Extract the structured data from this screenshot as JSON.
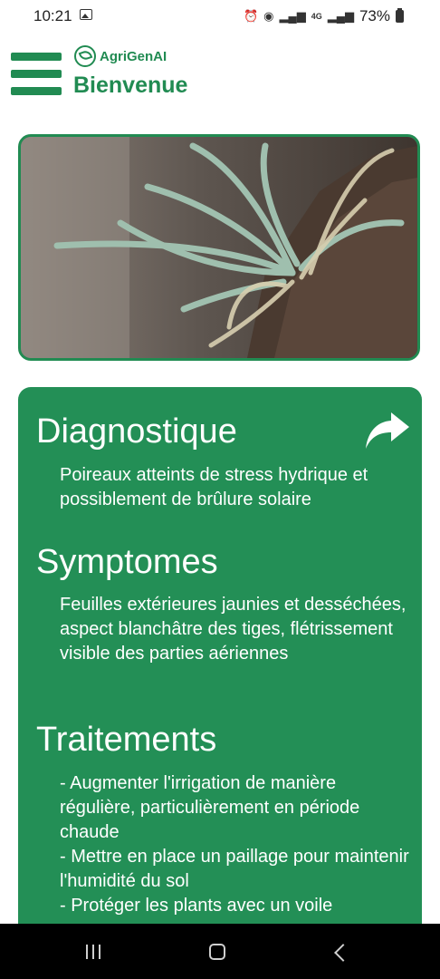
{
  "status_bar": {
    "time": "10:21",
    "network": "4G",
    "battery": "73%"
  },
  "app": {
    "logo_text": "AgriGenAI",
    "title": "Bienvenue",
    "accent_color": "#218b52"
  },
  "result": {
    "diagnostic": {
      "heading": "Diagnostique",
      "text": "Poireaux atteints de stress hydrique et possiblement de brûlure solaire"
    },
    "symptoms": {
      "heading": "Symptomes",
      "text": "Feuilles extérieures jaunies et desséchées, aspect blanchâtre des tiges, flétrissement visible des parties aériennes"
    },
    "treatments": {
      "heading": "Traitements",
      "items": [
        "- Augmenter l'irrigation de manière régulière, particulièrement en période chaude",
        "- Mettre en place un paillage pour maintenir l'humidité du sol",
        "- Protéger les plants avec un voile"
      ]
    }
  },
  "icons": {
    "share": "share-arrow-icon",
    "menu": "hamburger-menu-icon"
  }
}
